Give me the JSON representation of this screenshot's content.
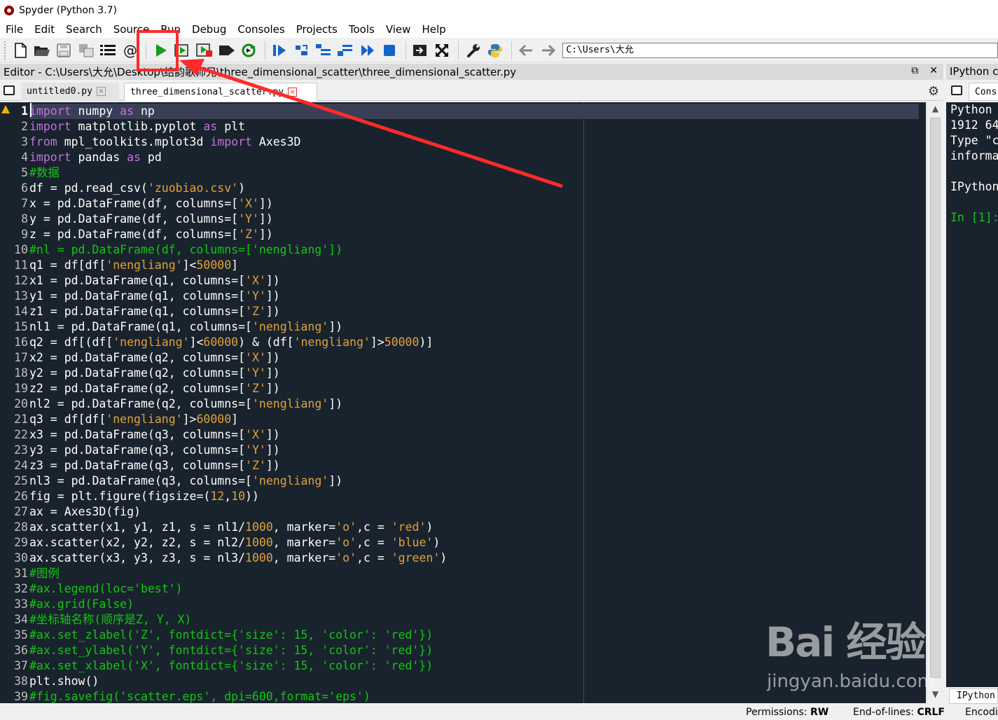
{
  "window": {
    "title": "Spyder (Python 3.7)"
  },
  "menu": [
    "File",
    "Edit",
    "Search",
    "Source",
    "Run",
    "Debug",
    "Consoles",
    "Projects",
    "Tools",
    "View",
    "Help"
  ],
  "toolbar": {
    "working_dir": "C:\\Users\\大允",
    "icons": [
      "new-file-icon",
      "open-file-icon",
      "save-icon",
      "save-all-icon",
      "outline-icon",
      "at-icon",
      "run-icon",
      "run-cell-icon",
      "run-cell-advance-icon",
      "run-selection-icon",
      "rerun-icon",
      "debug-icon",
      "step-icon",
      "step-into-icon",
      "step-return-icon",
      "continue-icon",
      "stop-debug-icon",
      "maximize-pane-icon",
      "fullscreen-icon",
      "preferences-icon",
      "python-path-icon",
      "back-arrow-icon",
      "forward-arrow-icon"
    ]
  },
  "editor": {
    "header": "Editor - C:\\Users\\大允\\Desktop\\结韵歌师兄\\three_dimensional_scatter\\three_dimensional_scatter.py",
    "tabs": [
      {
        "label": "untitled0.py",
        "active": false
      },
      {
        "label": "three_dimensional_scatter.py",
        "active": true
      }
    ],
    "lines": [
      "import numpy as np",
      "import matplotlib.pyplot as plt",
      "from mpl_toolkits.mplot3d import Axes3D",
      "import pandas as pd",
      "#数据",
      "df = pd.read_csv('zuobiao.csv')",
      "x = pd.DataFrame(df, columns=['X'])",
      "y = pd.DataFrame(df, columns=['Y'])",
      "z = pd.DataFrame(df, columns=['Z'])",
      "#nl = pd.DataFrame(df, columns=['nengliang'])",
      "q1 = df[df['nengliang']<50000]",
      "x1 = pd.DataFrame(q1, columns=['X'])",
      "y1 = pd.DataFrame(q1, columns=['Y'])",
      "z1 = pd.DataFrame(q1, columns=['Z'])",
      "nl1 = pd.DataFrame(q1, columns=['nengliang'])",
      "q2 = df[(df['nengliang']<60000) & (df['nengliang']>50000)]",
      "x2 = pd.DataFrame(q2, columns=['X'])",
      "y2 = pd.DataFrame(q2, columns=['Y'])",
      "z2 = pd.DataFrame(q2, columns=['Z'])",
      "nl2 = pd.DataFrame(q2, columns=['nengliang'])",
      "q3 = df[df['nengliang']>60000]",
      "x3 = pd.DataFrame(q3, columns=['X'])",
      "y3 = pd.DataFrame(q3, columns=['Y'])",
      "z3 = pd.DataFrame(q3, columns=['Z'])",
      "nl3 = pd.DataFrame(q3, columns=['nengliang'])",
      "fig = plt.figure(figsize=(12,10))",
      "ax = Axes3D(fig)",
      "ax.scatter(x1, y1, z1, s = nl1/1000, marker='o',c = 'red')",
      "ax.scatter(x2, y2, z2, s = nl2/1000, marker='o',c = 'blue')",
      "ax.scatter(x3, y3, z3, s = nl3/1000, marker='o',c = 'green')",
      "#图例",
      "#ax.legend(loc='best')",
      "#ax.grid(False)",
      "#坐标轴名称(顺序是Z, Y, X)",
      "#ax.set_zlabel('Z', fontdict={'size': 15, 'color': 'red'})",
      "#ax.set_ylabel('Y', fontdict={'size': 15, 'color': 'red'})",
      "#ax.set_xlabel('X', fontdict={'size': 15, 'color': 'red'})",
      "plt.show()",
      "#fig.savefig('scatter.eps', dpi=600,format='eps')"
    ],
    "current_line": 1
  },
  "ipython": {
    "header": "IPython c",
    "tab": "Cons",
    "lines": [
      "Python ",
      "1912 64",
      "Type \"c",
      "informa",
      "",
      "IPython",
      "",
      "In [1]:"
    ],
    "bottom_tab": "IPython"
  },
  "status": {
    "permissions_label": "Permissions:",
    "permissions_value": "RW",
    "eol_label": "End-of-lines:",
    "eol_value": "CRLF",
    "encoding_label": "Encodi"
  },
  "watermark": {
    "logo": "Bai 经验",
    "url": "jingyan.baidu.com"
  },
  "colors": {
    "editor_bg": "#19232d",
    "keyword": "#c670e0",
    "comment": "#13c613",
    "string": "#b0e686",
    "number": "#e3a13d",
    "annotation": "#ff2a2a"
  }
}
